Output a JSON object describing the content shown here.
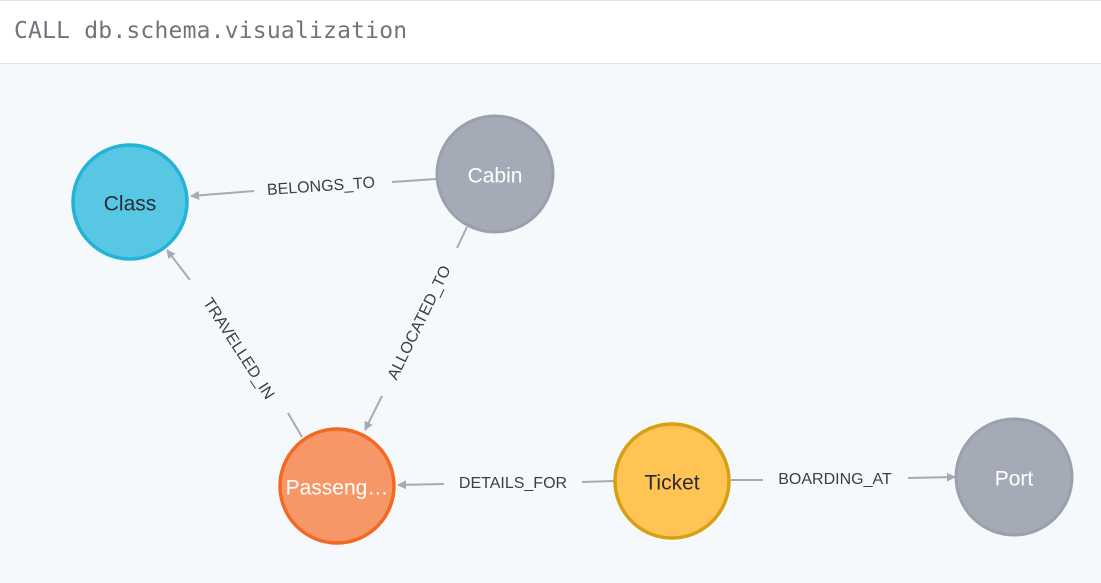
{
  "query": {
    "text": "CALL db.schema.visualization"
  },
  "graph": {
    "nodes": [
      {
        "id": "class",
        "label": "Class",
        "fill": "#57c7e3",
        "stroke": "#23b3d7",
        "text_color": "#2a2c34"
      },
      {
        "id": "cabin",
        "label": "Cabin",
        "fill": "#a5abb6",
        "stroke": "#9aa1ac",
        "text_color": "#ffffff"
      },
      {
        "id": "passenger",
        "label": "Passeng…",
        "fill": "#f79767",
        "stroke": "#f36924",
        "text_color": "#ffffff"
      },
      {
        "id": "ticket",
        "label": "Ticket",
        "fill": "#ffc454",
        "stroke": "#d7a013",
        "text_color": "#2a2c34"
      },
      {
        "id": "port",
        "label": "Port",
        "fill": "#a5abb6",
        "stroke": "#9aa1ac",
        "text_color": "#ffffff"
      }
    ],
    "relationships": [
      {
        "id": "belongs_to",
        "type": "BELONGS_TO",
        "from": "cabin",
        "to": "class"
      },
      {
        "id": "allocated_to",
        "type": "ALLOCATED_TO",
        "from": "cabin",
        "to": "passenger"
      },
      {
        "id": "travelled_in",
        "type": "TRAVELLED_IN",
        "from": "passenger",
        "to": "class"
      },
      {
        "id": "details_for",
        "type": "DETAILS_FOR",
        "from": "ticket",
        "to": "passenger"
      },
      {
        "id": "boarding_at",
        "type": "BOARDING_AT",
        "from": "ticket",
        "to": "port"
      }
    ],
    "relationship_color": "#a5abb6",
    "canvas_background": "#f6f9fc"
  }
}
